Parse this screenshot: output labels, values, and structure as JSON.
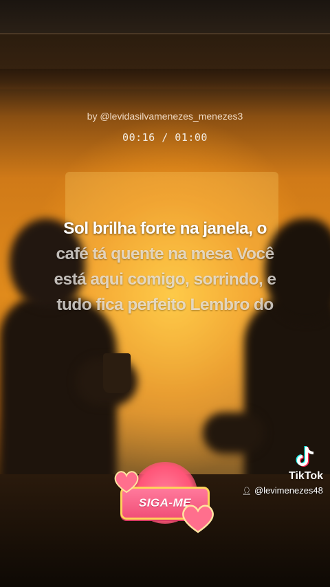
{
  "video": {
    "credit": "by @levidasilvamenezes_menezes3",
    "timer": "00:16 / 01:00"
  },
  "lyrics": {
    "lines": [
      "Sol brilha forte na janela, o",
      "café tá quente na mesa Você",
      "está aqui comigo, sorrindo, e",
      "tudo fica perfeito Lembro do"
    ]
  },
  "overlay": {
    "follow_button_label": "SIGA-ME",
    "watermark_brand": "TikTok",
    "watermark_handle": "@levimenezes48",
    "accent_pink": "#f14f78",
    "accent_gold": "#ffd35a"
  },
  "icons": [
    "tiktok-logo-icon",
    "person-icon",
    "heart-icon"
  ]
}
